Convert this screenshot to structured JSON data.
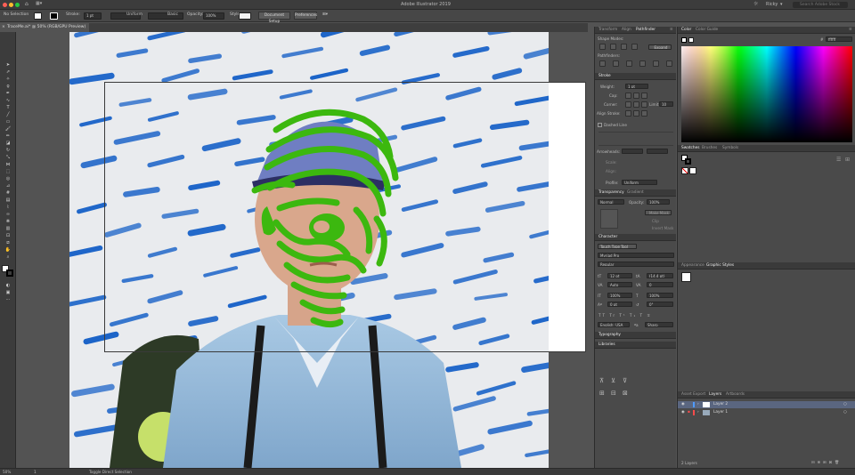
{
  "menubar": {
    "app_title": "Adobe Illustrator 2019",
    "workspace": "Ricky",
    "search_placeholder": "Search Adobe Stock"
  },
  "control_bar": {
    "selection_label": "No Selection",
    "stroke_label": "Stroke:",
    "stroke_weight": "1 pt",
    "uniform_label": "Uniform",
    "style_basic": "Basic",
    "opacity_label": "Opacity:",
    "opacity_value": "100%",
    "style_label": "Style:",
    "document_setup_button": "Document Setup",
    "preferences_button": "Preferences"
  },
  "document_tab": {
    "title": "TraceMe.ai* @ 50% (RGB/GPU Preview)"
  },
  "status_bar": {
    "zoom": "50%",
    "artboard": "1",
    "tool_label": "Toggle Direct Selection"
  },
  "panels_col1": {
    "tabs": [
      "Transform",
      "Align",
      "Pathfinder"
    ],
    "shape_modes_label": "Shape Modes:",
    "expand_button": "Expand",
    "pathfinders_label": "Pathfinders:",
    "stroke_header": "Stroke",
    "weight_label": "Weight:",
    "weight_value": "1 pt",
    "cap_label": "Cap:",
    "corner_label": "Corner:",
    "limit_label": "Limit:",
    "limit_value": "10",
    "align_stroke_label": "Align Stroke:",
    "dashed_line_label": "Dashed Line",
    "arrowheads_label": "Arrowheads:",
    "scale_label": "Scale:",
    "align_label": "Align:",
    "profile_label": "Profile:",
    "profile_value": "Uniform",
    "transparency_tabs": [
      "Transparency",
      "Gradient"
    ],
    "blend_mode": "Normal",
    "opacity_label": "Opacity:",
    "opacity_value": "100%",
    "make_mask_button": "Make Mask",
    "clip_label": "Clip",
    "invert_mask_label": "Invert Mask",
    "character_header": "Character",
    "touch_type_tool": "Touch Type Tool",
    "font_family": "Myriad Pro",
    "font_style": "Regular",
    "font_size": "12 pt",
    "leading": "(14.4 pt)",
    "kerning": "Auto",
    "tracking": "0",
    "vertical_scale": "100%",
    "horizontal_scale": "100%",
    "baseline_shift": "0 pt",
    "rotation": "0°",
    "language": "English: USA",
    "aa_method": "Sharp",
    "typography_header": "Typography",
    "libraries_header": "Libraries"
  },
  "panels_col2": {
    "color_tabs": [
      "Color",
      "Color Guide"
    ],
    "hex_value": "ffffff",
    "swatch_tabs": [
      "Swatches",
      "Brushes",
      "Symbols"
    ],
    "appearance_tabs": [
      "Appearance",
      "Graphic Styles"
    ],
    "layers_tabs": [
      "Asset Export",
      "Layers",
      "Artboards"
    ],
    "layers": [
      {
        "name": "Layer 2",
        "color": "#4f9bff"
      },
      {
        "name": "Layer 1",
        "color": "#ff4b4b"
      }
    ],
    "layers_count": "2 Layers"
  },
  "colors": {
    "accent_green": "#3cb80f",
    "brush_blue": "#1c64c8"
  }
}
